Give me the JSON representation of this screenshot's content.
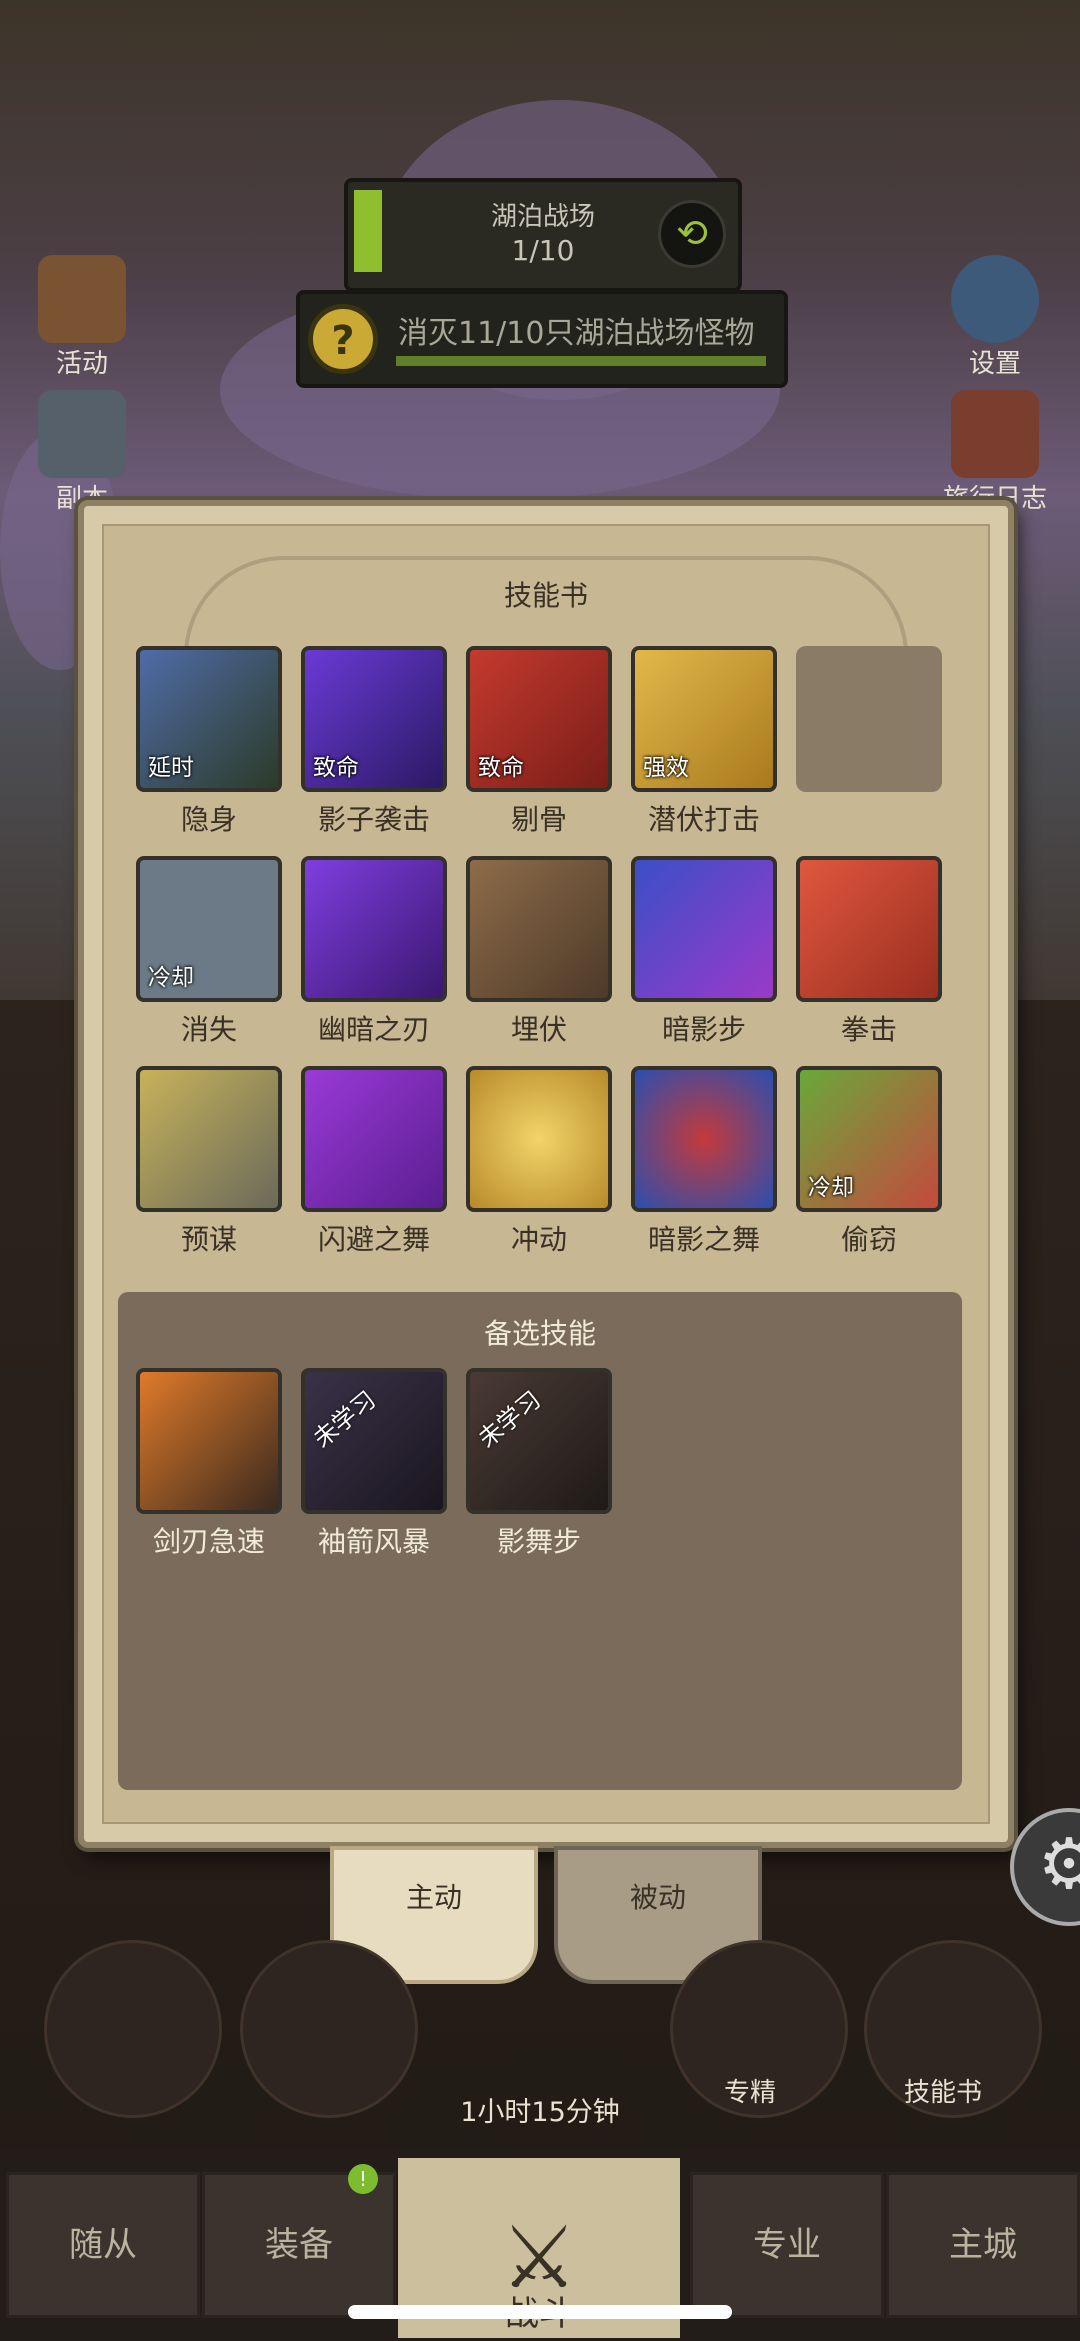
{
  "quest": {
    "area_name": "湖泊战场",
    "progress_text": "1/10",
    "goal_text": "消灭11/10只湖泊战场怪物"
  },
  "side_buttons": {
    "left": [
      "活动",
      "副本"
    ],
    "right": [
      "设置",
      "旅行日志"
    ]
  },
  "skillbook": {
    "title": "技能书",
    "rows": [
      [
        {
          "name": "隐身",
          "tag": "延时"
        },
        {
          "name": "影子袭击",
          "tag": "致命"
        },
        {
          "name": "剔骨",
          "tag": "致命"
        },
        {
          "name": "潜伏打击",
          "tag": "强效"
        },
        {
          "name": "",
          "tag": ""
        }
      ],
      [
        {
          "name": "消失",
          "tag": "冷却"
        },
        {
          "name": "幽暗之刃",
          "tag": ""
        },
        {
          "name": "埋伏",
          "tag": ""
        },
        {
          "name": "暗影步",
          "tag": ""
        },
        {
          "name": "拳击",
          "tag": ""
        }
      ],
      [
        {
          "name": "预谋",
          "tag": ""
        },
        {
          "name": "闪避之舞",
          "tag": ""
        },
        {
          "name": "冲动",
          "tag": ""
        },
        {
          "name": "暗影之舞",
          "tag": ""
        },
        {
          "name": "偷窃",
          "tag": "冷却"
        }
      ]
    ],
    "alternate_title": "备选技能",
    "alternates": [
      {
        "name": "剑刃急速",
        "tag": ""
      },
      {
        "name": "袖箭风暴",
        "tag": "未学习"
      },
      {
        "name": "影舞步",
        "tag": "未学习"
      }
    ]
  },
  "tabs": {
    "active": "主动",
    "passive": "被动"
  },
  "bottom_buttons": {
    "specialization": "专精",
    "skillbook": "技能书"
  },
  "timer": "1小时15分钟",
  "nav": {
    "followers": "随从",
    "equipment": "装备",
    "battle": "战斗",
    "profession": "专业",
    "city": "主城",
    "badge": "!"
  }
}
